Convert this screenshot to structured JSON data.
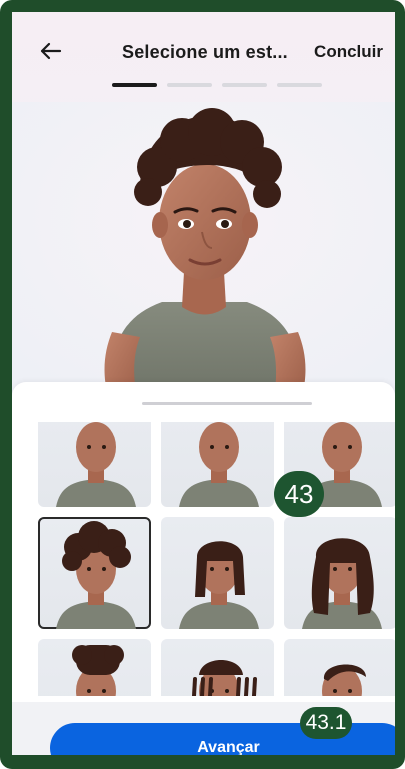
{
  "header": {
    "title": "Selecione um est...",
    "done_label": "Concluir",
    "steps": [
      true,
      false,
      false,
      false
    ]
  },
  "grid": {
    "selected_index": 3,
    "tiles": [
      {
        "hair": "partial-row"
      },
      {
        "hair": "partial-row"
      },
      {
        "hair": "partial-row"
      },
      {
        "hair": "afro"
      },
      {
        "hair": "shoulder-length"
      },
      {
        "hair": "long-wavy"
      },
      {
        "hair": "high-top"
      },
      {
        "hair": "dreadlocks"
      },
      {
        "hair": "short-side-part"
      }
    ]
  },
  "annotations": {
    "badge1": "43",
    "badge2": "43.1"
  },
  "footer": {
    "cta_label": "Avançar"
  },
  "colors": {
    "accent": "#0a64e0",
    "frame": "#1f4d2a",
    "badge": "#1e5530",
    "hair": "#3a1f17",
    "skin": "#b0735c",
    "shirt": "#7d8275"
  }
}
